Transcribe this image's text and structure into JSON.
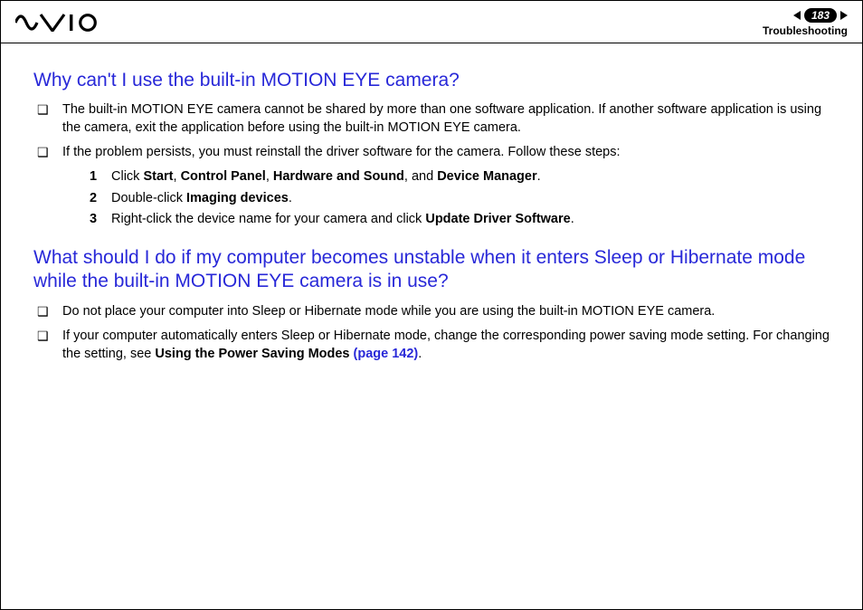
{
  "header": {
    "page_number": "183",
    "section": "Troubleshooting"
  },
  "q1": {
    "title": "Why can't I use the built-in MOTION EYE camera?",
    "b1": "The built-in MOTION EYE camera cannot be shared by more than one software application. If another software application is using the camera, exit the application before using the built-in MOTION EYE camera.",
    "b2_lead": "If the problem persists, you must reinstall the driver software for the camera. Follow these steps:",
    "s1_pre": "Click ",
    "s1_start": "Start",
    "s1_c1": ", ",
    "s1_cp": "Control Panel",
    "s1_c2": ", ",
    "s1_hs": "Hardware and Sound",
    "s1_c3": ", and ",
    "s1_dm": "Device Manager",
    "s1_end": ".",
    "s2_pre": "Double-click ",
    "s2_id": "Imaging devices",
    "s2_end": ".",
    "s3_pre": "Right-click the device name for your camera and click ",
    "s3_uds": "Update Driver Software",
    "s3_end": "."
  },
  "q2": {
    "title": "What should I do if my computer becomes unstable when it enters Sleep or Hibernate mode while the built-in MOTION EYE camera is in use?",
    "b1": "Do not place your computer into Sleep or Hibernate mode while you are using the built-in MOTION EYE camera.",
    "b2_pre": "If your computer automatically enters Sleep or Hibernate mode, change the corresponding power saving mode setting. For changing the setting, see ",
    "b2_bold": "Using the Power Saving Modes ",
    "b2_link": "(page 142)",
    "b2_end": "."
  }
}
